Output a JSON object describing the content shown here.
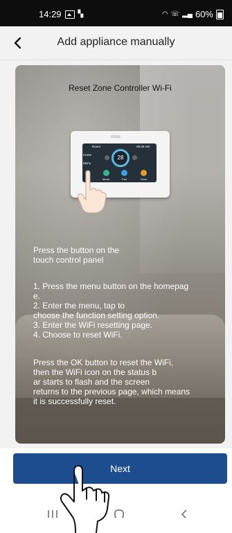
{
  "status_bar": {
    "time": "14:29",
    "battery": "60%"
  },
  "header": {
    "title": "Add appliance manually",
    "back_icon": "chevron-left-icon"
  },
  "card": {
    "title": "Reset Zone Controller Wi-Fi",
    "device": {
      "brand": "GREE",
      "room_label": "Room",
      "time": "08:30 AM",
      "temperature": "28",
      "home_label": "Home",
      "menu_label": "Menu",
      "mode_label": "Mode",
      "fan_label": "Fan",
      "zone_label": "Zone"
    },
    "intro": "Press the button on the\ntouch control panel",
    "steps": "1. Press the menu button on the homepag\ne.\n2. Enter the menu, tap to\nchoose the function setting option.\n3. Enter the WiFi resetting page.\n4. Choose to reset WiFi.",
    "note": "Press the OK button to reset the WiFi,\nthen the WiFi icon on the status b\nar starts to flash and the screen\nreturns to the previous page, which means\nit is successfully reset."
  },
  "next_button": {
    "label": "Next"
  },
  "colors": {
    "primary": "#1d4d8f",
    "status_bar": "#0d0d0d",
    "header_bg": "#f2f2f2"
  }
}
